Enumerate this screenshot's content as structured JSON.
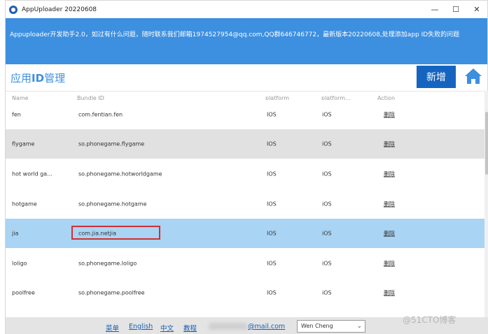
{
  "window": {
    "title": "AppUploader 20220608",
    "minimize_glyph": "—",
    "maximize_glyph": "☐",
    "close_glyph": "✕"
  },
  "banner": {
    "text": "Appuploader开发助手2.0，如过有什么问题，随时联系我们邮箱1974527954@qq.com,QQ群646746772，最新版本20220608,处理添加app ID失败的问题"
  },
  "header": {
    "title_prefix": "应用",
    "title_id": "ID",
    "title_suffix": "管理",
    "add_button": "新增",
    "home_icon": "home-icon",
    "accent": "#3d8fe0",
    "button_color": "#1565c0"
  },
  "table": {
    "columns": [
      "Name",
      "Bundle ID",
      "platform",
      "platform...",
      "Action"
    ],
    "rows": [
      {
        "name": "fen",
        "bundle_id": "com.fentian.fen",
        "platform": "IOS",
        "platform2": "iOS",
        "action": "删除"
      },
      {
        "name": "flygame",
        "bundle_id": "so.phonegame.flygame",
        "platform": "IOS",
        "platform2": "iOS",
        "action": "删除"
      },
      {
        "name": "hot world ga...",
        "bundle_id": "so.phonegame.hotworldgame",
        "platform": "IOS",
        "platform2": "iOS",
        "action": "删除"
      },
      {
        "name": "hotgame",
        "bundle_id": "so.phonegame.hotgame",
        "platform": "IOS",
        "platform2": "iOS",
        "action": "删除"
      },
      {
        "name": "jia",
        "bundle_id": "com.jia.netjia",
        "platform": "IOS",
        "platform2": "iOS",
        "action": "删除"
      },
      {
        "name": "loligo",
        "bundle_id": "so.phonegame.loligo",
        "platform": "IOS",
        "platform2": "iOS",
        "action": "删除"
      },
      {
        "name": "poolfree",
        "bundle_id": "so.phonegame.poolfree",
        "platform": "IOS",
        "platform2": "iOS",
        "action": "删除"
      }
    ],
    "selected_color": "#a9d4f4",
    "highlight_color": "#d23030"
  },
  "footer": {
    "links": [
      "菜单",
      "English",
      "中文",
      "教程"
    ],
    "email_partial": "@mail.com",
    "account": "Wen Cheng",
    "dropdown_icon": "chevron-down-icon"
  },
  "watermark": "@51CTO博客"
}
